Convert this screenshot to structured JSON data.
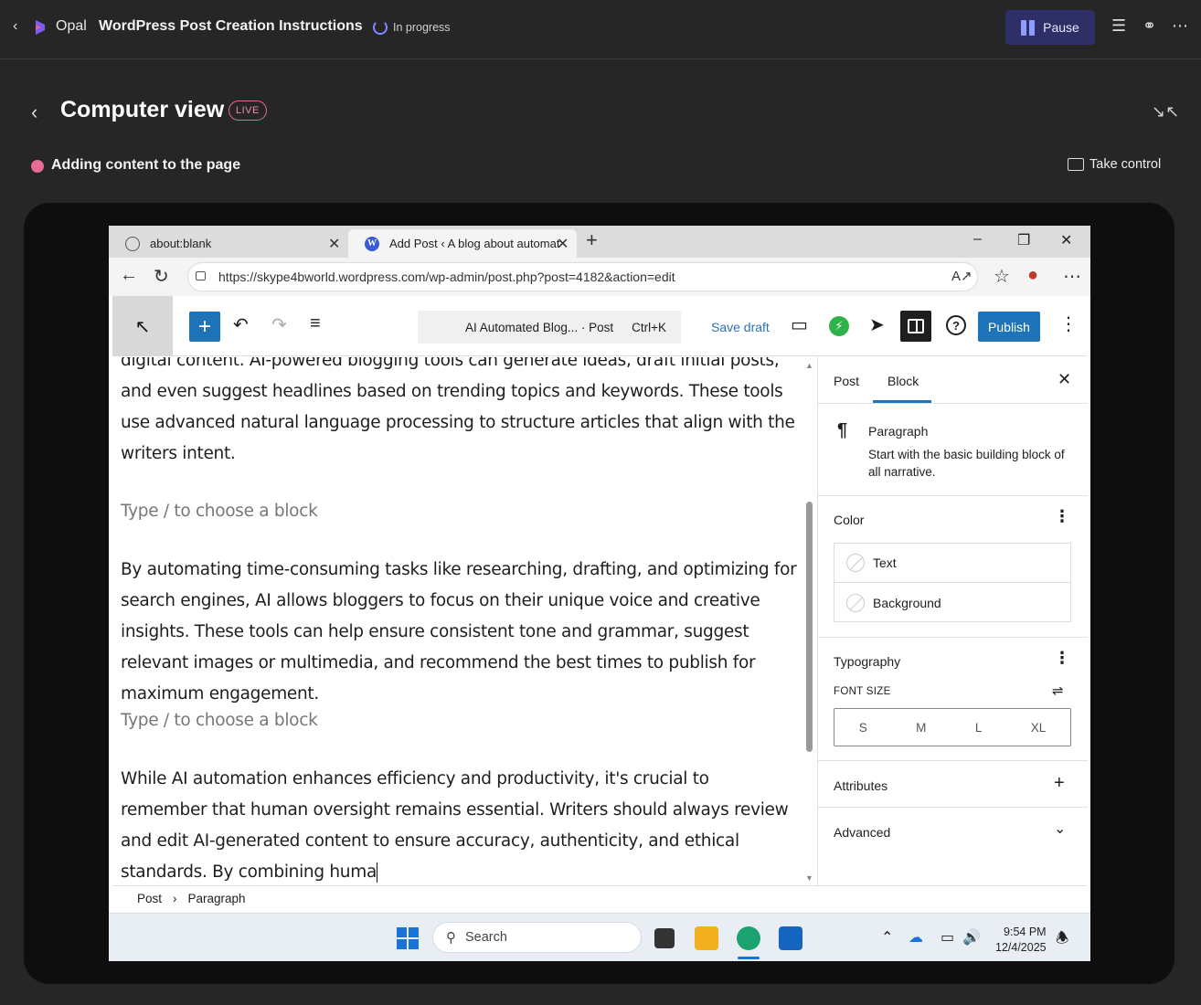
{
  "app": {
    "name": "Opal",
    "task_title": "WordPress Post Creation Instructions",
    "status": "In progress",
    "pause_label": "Pause"
  },
  "computer_view": {
    "title": "Computer view",
    "live_badge": "LIVE",
    "activity": "Adding content to the page",
    "take_control": "Take control"
  },
  "browser": {
    "tabs": [
      {
        "label": "about:blank"
      },
      {
        "label": "Add Post ‹ A blog about automat"
      }
    ],
    "url": "https://skype4bworld.wordpress.com/wp-admin/post.php?post=4182&action=edit"
  },
  "editor": {
    "command_bar": {
      "title": "AI Automated Blog... · Post",
      "shortcut": "Ctrl+K"
    },
    "save_draft": "Save draft",
    "publish": "Publish",
    "paragraphs": [
      "digital content. AI-powered blogging tools can generate ideas, draft initial posts, and even suggest headlines based on trending topics and keywords. These tools use advanced natural language processing to structure articles that align with the writers intent.",
      "By automating time-consuming tasks like researching, drafting, and optimizing for search engines, AI allows bloggers to focus on their unique voice and creative insights. These tools can help ensure consistent tone and grammar, suggest relevant images or multimedia, and recommend the best times to publish for maximum engagement.",
      "While AI automation enhances efficiency and productivity, it's crucial to remember that human oversight remains essential. Writers should always review and edit AI-generated content to ensure accuracy, authenticity, and ethical standards. By combining huma"
    ],
    "placeholder": "Type / to choose a block",
    "breadcrumbs": [
      "Post",
      "Paragraph"
    ]
  },
  "sidebar": {
    "tabs": [
      "Post",
      "Block"
    ],
    "active_tab": "Block",
    "block": {
      "name": "Paragraph",
      "description": "Start with the basic building block of all narrative."
    },
    "color": {
      "title": "Color",
      "items": [
        "Text",
        "Background"
      ]
    },
    "typography": {
      "title": "Typography",
      "font_size_label": "FONT SIZE",
      "sizes": [
        "S",
        "M",
        "L",
        "XL"
      ]
    },
    "attributes": "Attributes",
    "advanced": "Advanced"
  },
  "taskbar": {
    "search_placeholder": "Search",
    "time": "9:54 PM",
    "date": "12/4/2025"
  },
  "colors": {
    "accent": "#1f74b9",
    "live": "#e26a8c",
    "pause_bg": "#2d2f66"
  }
}
